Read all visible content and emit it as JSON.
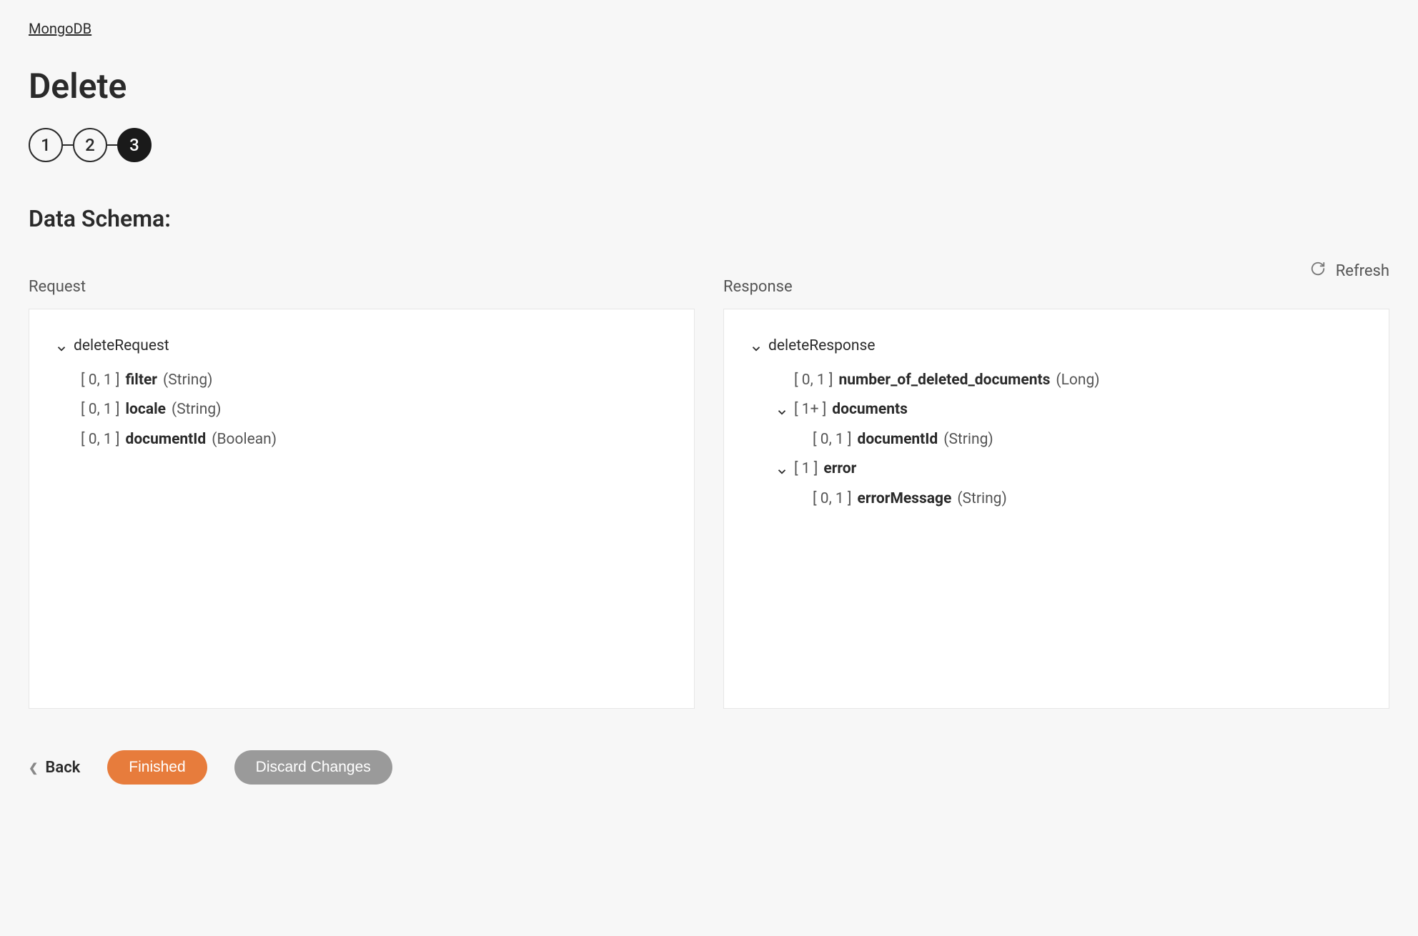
{
  "breadcrumb": "MongoDB",
  "page_title": "Delete",
  "stepper": {
    "steps": [
      "1",
      "2",
      "3"
    ],
    "active_index": 2
  },
  "section_title": "Data Schema:",
  "refresh_label": "Refresh",
  "request_label": "Request",
  "response_label": "Response",
  "request_schema": {
    "root": "deleteRequest",
    "fields": [
      {
        "card": "[ 0, 1 ]",
        "name": "filter",
        "type": "(String)"
      },
      {
        "card": "[ 0, 1 ]",
        "name": "locale",
        "type": "(String)"
      },
      {
        "card": "[ 0, 1 ]",
        "name": "documentId",
        "type": "(Boolean)"
      }
    ]
  },
  "response_schema": {
    "root": "deleteResponse",
    "top_field": {
      "card": "[ 0, 1 ]",
      "name": "number_of_deleted_documents",
      "type": "(Long)"
    },
    "group1": {
      "card": "[ 1+ ]",
      "name": "documents",
      "child": {
        "card": "[ 0, 1 ]",
        "name": "documentId",
        "type": "(String)"
      }
    },
    "group2": {
      "card": "[ 1 ]",
      "name": "error",
      "child": {
        "card": "[ 0, 1 ]",
        "name": "errorMessage",
        "type": "(String)"
      }
    }
  },
  "footer": {
    "back": "Back",
    "finished": "Finished",
    "discard": "Discard Changes"
  }
}
